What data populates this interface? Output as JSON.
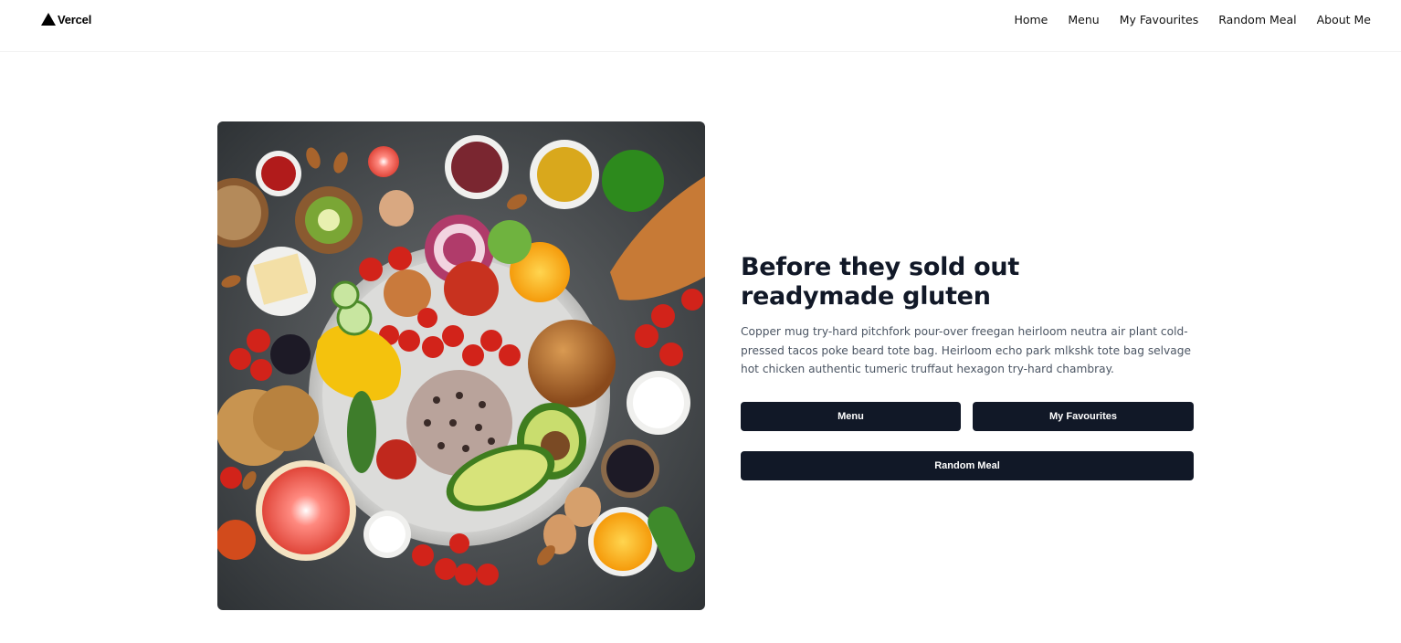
{
  "header": {
    "brand": "Vercel",
    "nav": [
      "Home",
      "Menu",
      "My Favourites",
      "Random Meal",
      "About Me"
    ]
  },
  "hero": {
    "title_line1": "Before they sold out",
    "title_line2": "readymade gluten",
    "description": "Copper mug try-hard pitchfork pour-over freegan heirloom neutra air plant cold-pressed tacos poke beard tote bag. Heirloom echo park mlkshk tote bag selvage hot chicken authentic tumeric truffaut hexagon try-hard chambray.",
    "buttons": {
      "menu": "Menu",
      "favourites": "My Favourites",
      "random": "Random Meal"
    }
  },
  "colors": {
    "button_bg": "#111827",
    "text_primary": "#111827",
    "text_secondary": "#4b5563"
  }
}
